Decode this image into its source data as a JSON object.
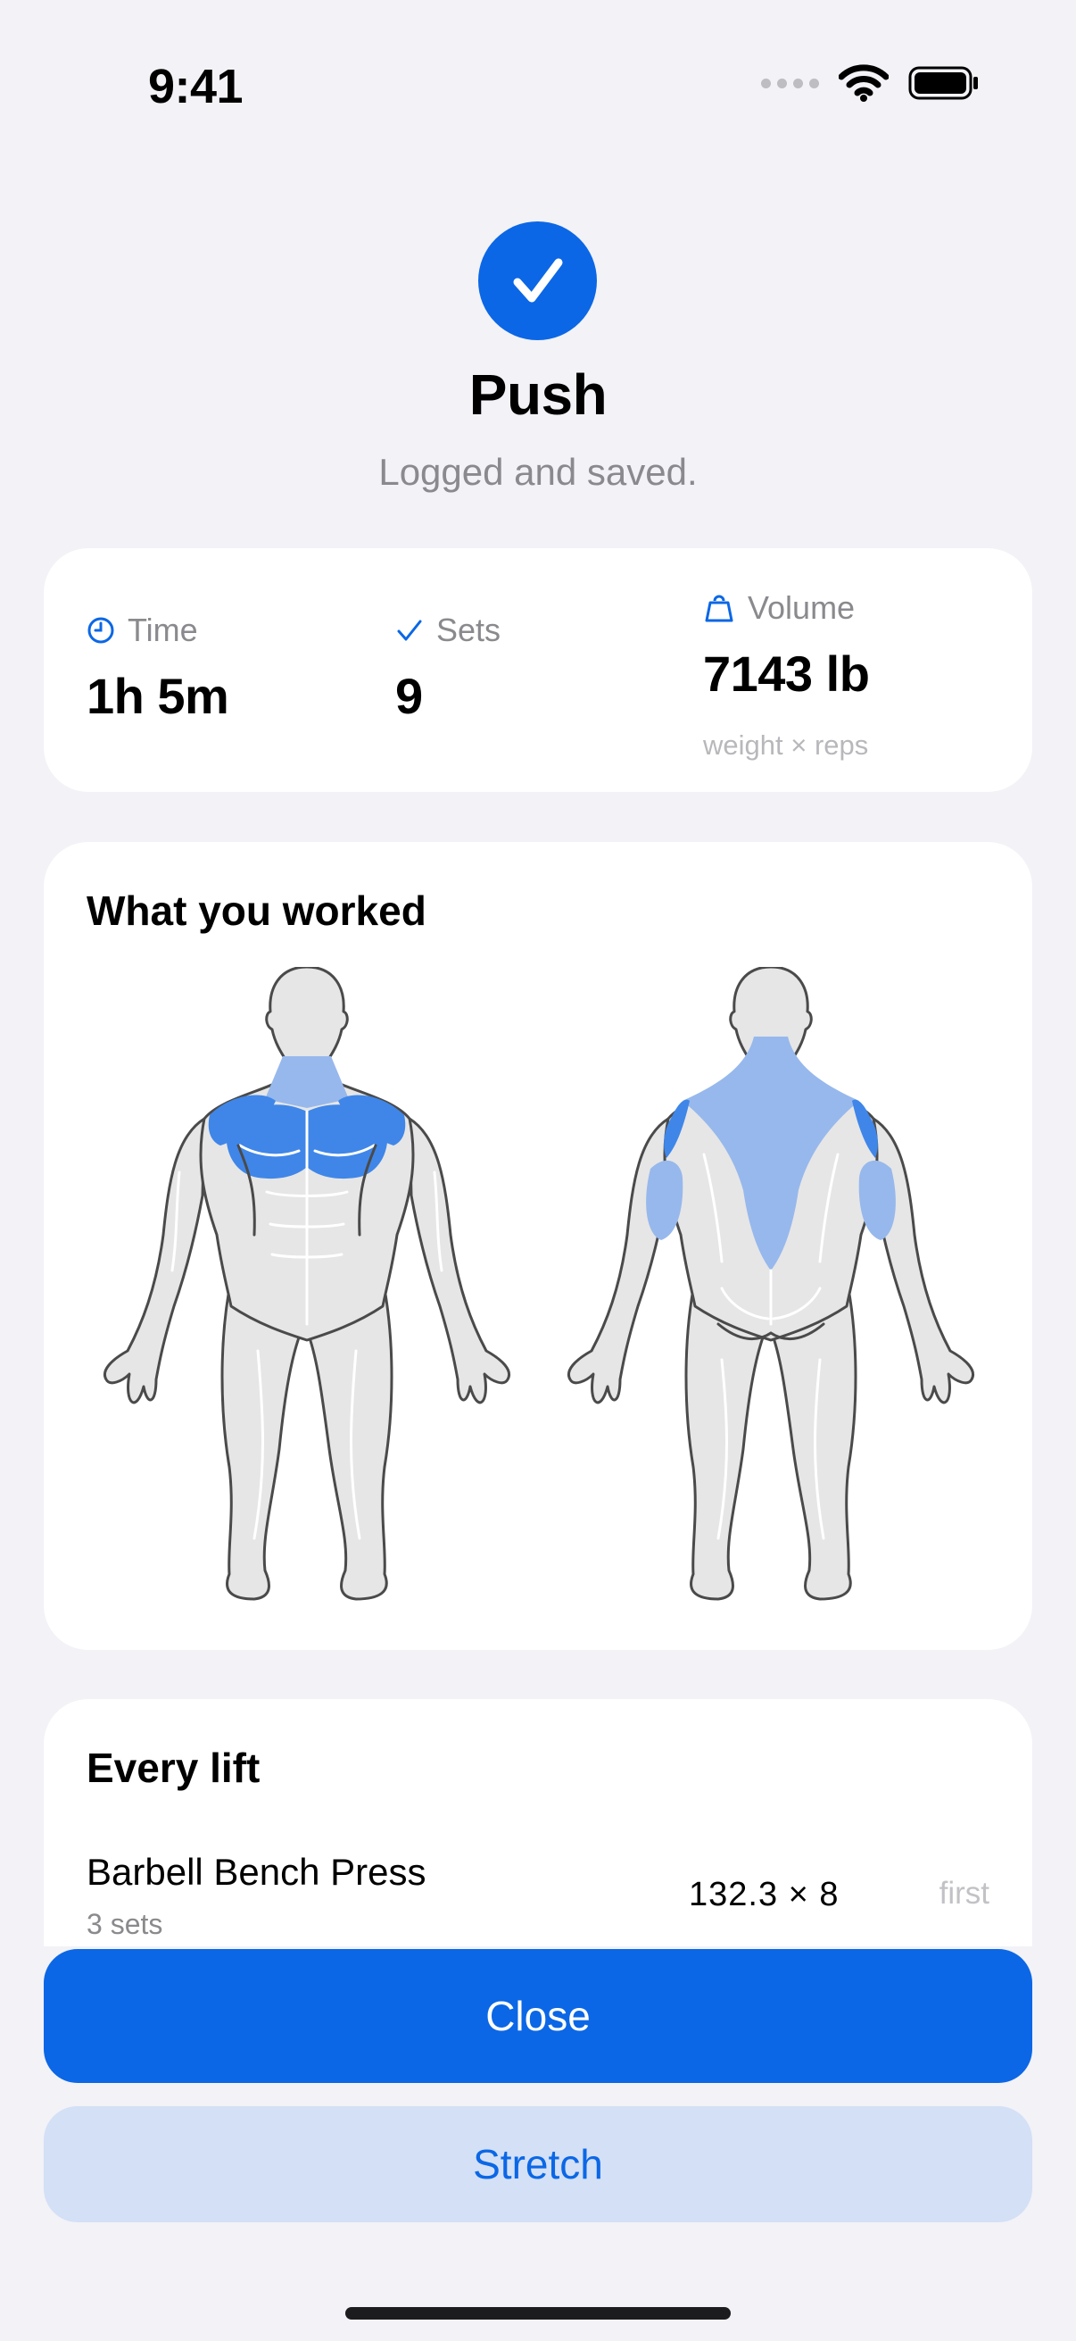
{
  "status_bar": {
    "time": "9:41"
  },
  "header": {
    "title": "Push",
    "subtitle": "Logged and saved."
  },
  "stats": {
    "time": {
      "label": "Time",
      "value": "1h 5m"
    },
    "sets": {
      "label": "Sets",
      "value": "9"
    },
    "volume": {
      "label": "Volume",
      "value": "7143 lb",
      "note": "weight × reps"
    }
  },
  "worked": {
    "heading": "What you worked",
    "front_view": {
      "highlighted": [
        "chest",
        "front-delts",
        "neck"
      ]
    },
    "back_view": {
      "highlighted": [
        "trapezius",
        "rear-delts",
        "triceps"
      ]
    }
  },
  "lifts": {
    "heading": "Every lift",
    "items": [
      {
        "name": "Barbell Bench Press",
        "sets": "3 sets",
        "weight": "132.3 × 8",
        "tag": "first"
      }
    ]
  },
  "buttons": {
    "close": "Close",
    "stretch": "Stretch"
  },
  "colors": {
    "accent": "#0b67e5",
    "muscle_primary": "#3f86e8",
    "muscle_secondary": "#97b8ec",
    "body_fill": "#e6e6e6",
    "body_stroke": "#4a4a4a"
  }
}
